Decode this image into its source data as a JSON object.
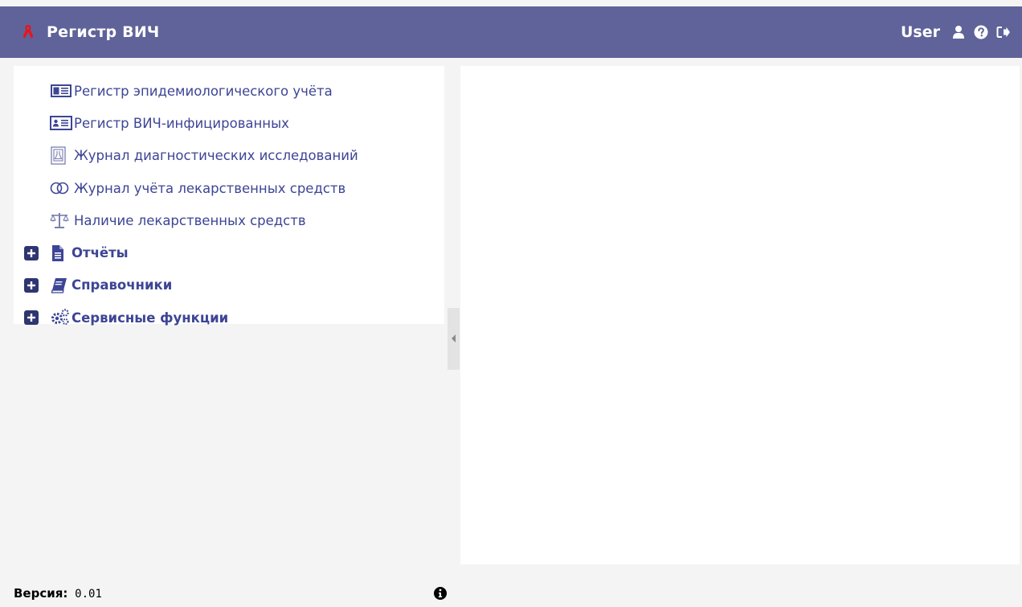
{
  "header": {
    "title": "Регистр ВИЧ",
    "logo_icon": "red-ribbon-icon",
    "user_name": "User",
    "icons": [
      "user-icon",
      "help-icon",
      "logout-icon"
    ]
  },
  "sidebar": {
    "items": [
      {
        "label": "Регистр эпидемиологического учёта",
        "icon": "id-card-icon"
      },
      {
        "label": "Регистр ВИЧ-инфицированных",
        "icon": "id-card-icon"
      },
      {
        "label": "Журнал диагностических исследований",
        "icon": "lab-flask-icon"
      },
      {
        "label": "Журнал учёта лекарственных средств",
        "icon": "pill-icon"
      },
      {
        "label": "Наличие лекарственных средств",
        "icon": "scales-icon"
      }
    ],
    "groups": [
      {
        "label": "Отчёты",
        "icon": "file-icon"
      },
      {
        "label": "Справочники",
        "icon": "book-icon"
      },
      {
        "label": "Сервисные функции",
        "icon": "gears-icon"
      }
    ]
  },
  "footer": {
    "version_label": "Версия:",
    "version_value": "0.01"
  },
  "colors": {
    "header_bg": "#5f6399",
    "link": "#3d4595",
    "ribbon": "#e8141c"
  }
}
